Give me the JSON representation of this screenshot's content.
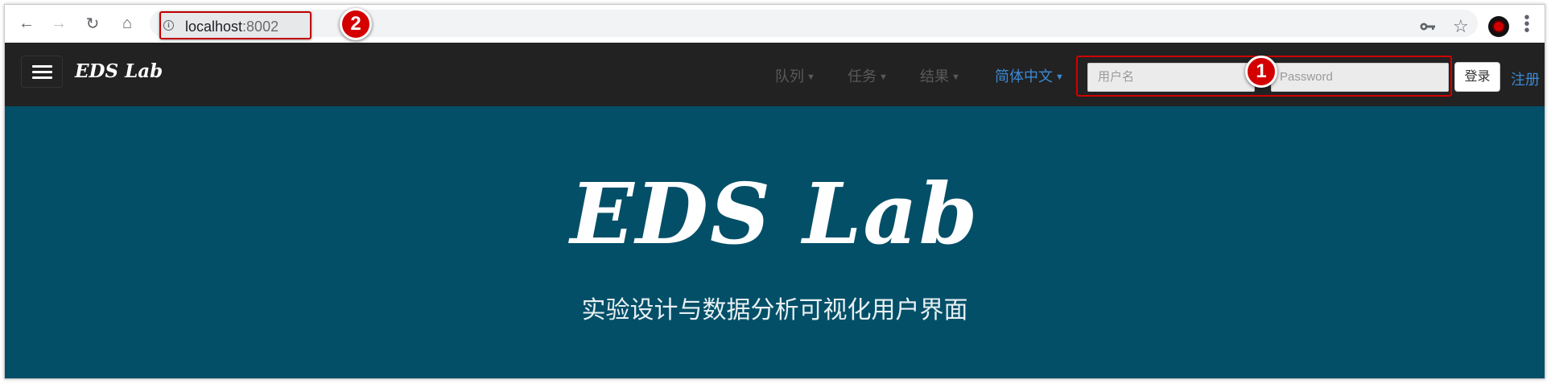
{
  "browser": {
    "url_host": "localhost",
    "url_port": ":8002",
    "back_icon": "arrow-left",
    "forward_icon": "arrow-right",
    "reload_icon": "reload",
    "home_icon": "home",
    "info_icon": "info",
    "key_icon": "key",
    "star_icon": "star",
    "menu_icon": "kebab-menu"
  },
  "annotations": {
    "marker_1": "1",
    "marker_2": "2",
    "highlight_color": "#d00000"
  },
  "navbar": {
    "brand": "EDS Lab",
    "menu_icon": "hamburger",
    "items": [
      {
        "label": "队列"
      },
      {
        "label": "任务"
      },
      {
        "label": "结果"
      }
    ],
    "language": "简体中文",
    "username_placeholder": "用户名",
    "password_placeholder": "Password",
    "login_label": "登录",
    "register_label": "注册"
  },
  "hero": {
    "title": "EDS Lab",
    "subtitle": "实验设计与数据分析可视化用户界面",
    "background": "#034f68"
  }
}
